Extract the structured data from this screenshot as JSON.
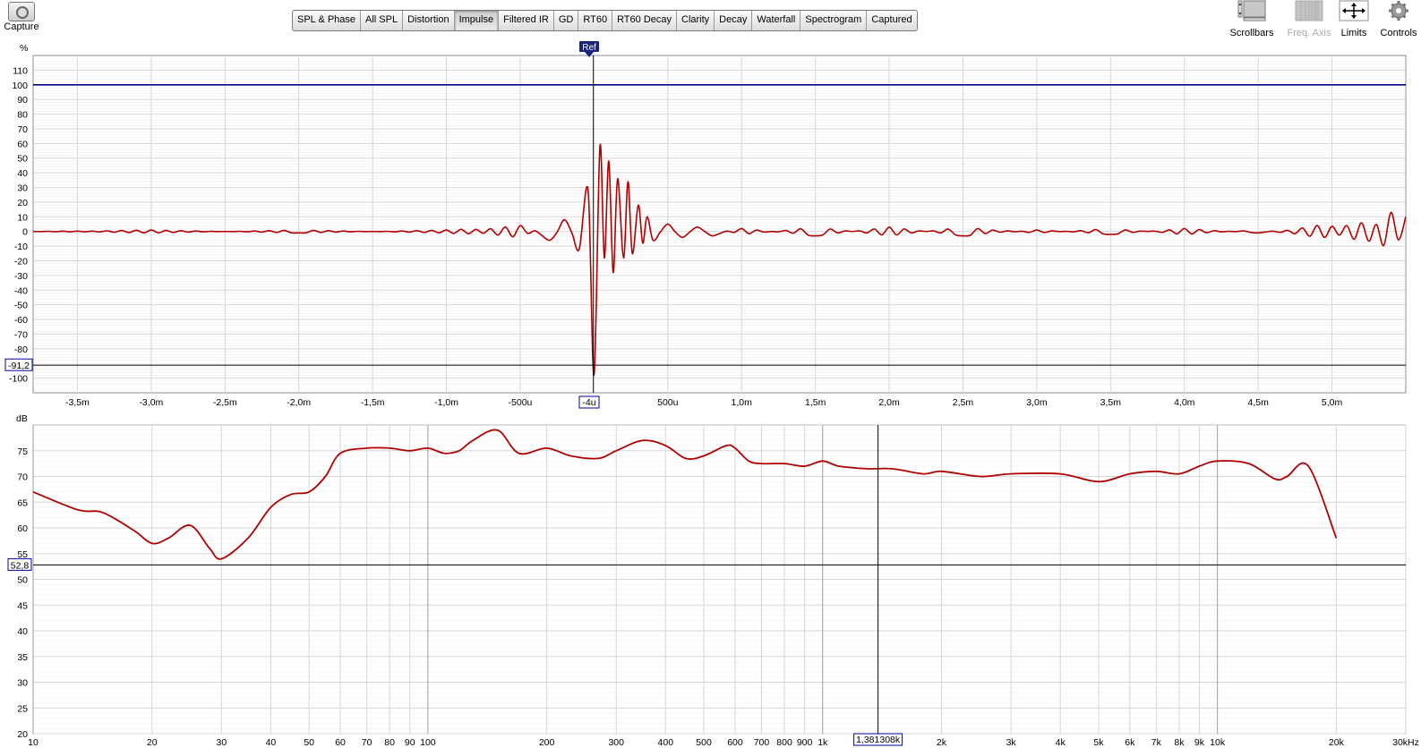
{
  "toolbar": {
    "capture_label": "Capture",
    "tabs": [
      "SPL & Phase",
      "All SPL",
      "Distortion",
      "Impulse",
      "Filtered IR",
      "GD",
      "RT60",
      "RT60 Decay",
      "Clarity",
      "Decay",
      "Waterfall",
      "Spectrogram",
      "Captured"
    ],
    "active_tab": "Impulse",
    "right_buttons": [
      {
        "label": "Scrollbars",
        "icon": "scrollbars-icon",
        "enabled": true
      },
      {
        "label": "Freq. Axis",
        "icon": "freq-axis-icon",
        "enabled": false
      },
      {
        "label": "Limits",
        "icon": "limits-icon",
        "enabled": true
      },
      {
        "label": "Controls",
        "icon": "gear-icon",
        "enabled": true
      }
    ]
  },
  "impulse_panel": {
    "y_unit": "%",
    "y_ticks": [
      "110",
      "100",
      "90",
      "80",
      "70",
      "60",
      "50",
      "40",
      "30",
      "20",
      "10",
      "0",
      "-10",
      "-20",
      "-30",
      "-40",
      "-50",
      "-60",
      "-70",
      "-80",
      "-100"
    ],
    "x_ticks": [
      "-3,5m",
      "-3,0m",
      "-2,5m",
      "-2,0m",
      "-1,5m",
      "-1,0m",
      "-500u",
      "500u",
      "1,0m",
      "1,5m",
      "2,0m",
      "2,5m",
      "3,0m",
      "3,5m",
      "4,0m",
      "4,5m",
      "5,0m"
    ],
    "cursor_x_label": "-4u",
    "cursor_y_label": "-91,2",
    "ref_marker_label": "Ref",
    "reference_level": "100"
  },
  "spl_panel": {
    "y_unit": "dB",
    "y_ticks": [
      "75",
      "70",
      "65",
      "60",
      "55",
      "50",
      "45",
      "40",
      "35",
      "30",
      "25",
      "20"
    ],
    "x_ticks": [
      "10",
      "20",
      "30",
      "40",
      "50",
      "60",
      "70",
      "80",
      "90",
      "100",
      "200",
      "300",
      "400",
      "500",
      "600",
      "700",
      "800",
      "900",
      "1k",
      "2k",
      "3k",
      "4k",
      "5k",
      "6k",
      "7k",
      "8k",
      "9k",
      "10k",
      "20k",
      "30kHz"
    ],
    "cursor_x_label": "1,381308k",
    "cursor_y_label": "52,8"
  },
  "colors": {
    "trace": "#b00000",
    "reference_line": "#00008b",
    "cursor_label_border": "#0000a0",
    "grid": "#d6d6d6"
  },
  "chart_data": [
    {
      "type": "line",
      "ylabel": "%",
      "x_unit": "s",
      "xlim": [
        -0.0038,
        0.0055
      ],
      "ylim": [
        -110,
        120
      ],
      "series": [
        {
          "x": [
            -0.0038,
            -0.003,
            -0.002,
            -0.001,
            -0.0005,
            -0.0003,
            -0.0002,
            -0.0001,
            -4e-05,
            0.0,
            4e-05,
            7e-05,
            0.0001,
            0.00013,
            0.00016,
            0.0002,
            0.00023,
            0.00026,
            0.0003,
            0.00033,
            0.00036,
            0.0004,
            0.0005,
            0.0006,
            0.0007,
            0.0008,
            0.001,
            0.0015,
            0.002,
            0.0025,
            0.003,
            0.0035,
            0.004,
            0.0045,
            0.0049,
            0.0052,
            0.0054,
            0.0055
          ],
          "y": [
            0,
            1,
            -1,
            1,
            4,
            -6,
            8,
            -12,
            28,
            -98,
            58,
            -18,
            48,
            -28,
            36,
            -18,
            34,
            -15,
            18,
            -8,
            10,
            -6,
            5,
            -4,
            3,
            -3,
            2,
            -3,
            3,
            -3,
            1,
            -2,
            2,
            -1,
            4,
            6,
            13,
            10
          ]
        }
      ]
    },
    {
      "type": "line",
      "ylabel": "dB",
      "x_unit": "Hz",
      "x_scale": "log",
      "xlim": [
        10,
        30000
      ],
      "ylim": [
        20,
        80
      ],
      "series": [
        {
          "x": [
            10,
            13,
            15,
            18,
            20,
            22,
            25,
            28,
            30,
            35,
            40,
            45,
            50,
            55,
            60,
            70,
            80,
            90,
            100,
            110,
            120,
            130,
            150,
            170,
            200,
            230,
            270,
            300,
            350,
            400,
            450,
            500,
            570,
            600,
            650,
            700,
            800,
            900,
            1000,
            1100,
            1300,
            1500,
            1800,
            2000,
            2500,
            3000,
            4000,
            5000,
            6000,
            7000,
            8000,
            9000,
            10000,
            12000,
            14000,
            15000,
            17000,
            20000
          ],
          "y": [
            67,
            63.5,
            63,
            59.5,
            57,
            58,
            60.5,
            56,
            54,
            58,
            64,
            66.5,
            67,
            70,
            74.5,
            75.5,
            75.5,
            75,
            75.5,
            74.5,
            75,
            77,
            79,
            74.5,
            75.5,
            74,
            73.5,
            75,
            77,
            76,
            73.5,
            74,
            76,
            75.5,
            73,
            72.5,
            72.5,
            72,
            73,
            72,
            71.5,
            71.5,
            70.5,
            71,
            70,
            70.5,
            70.5,
            69,
            70.5,
            71,
            70.5,
            72,
            73,
            72.5,
            69.5,
            70,
            72,
            58
          ]
        }
      ]
    }
  ]
}
